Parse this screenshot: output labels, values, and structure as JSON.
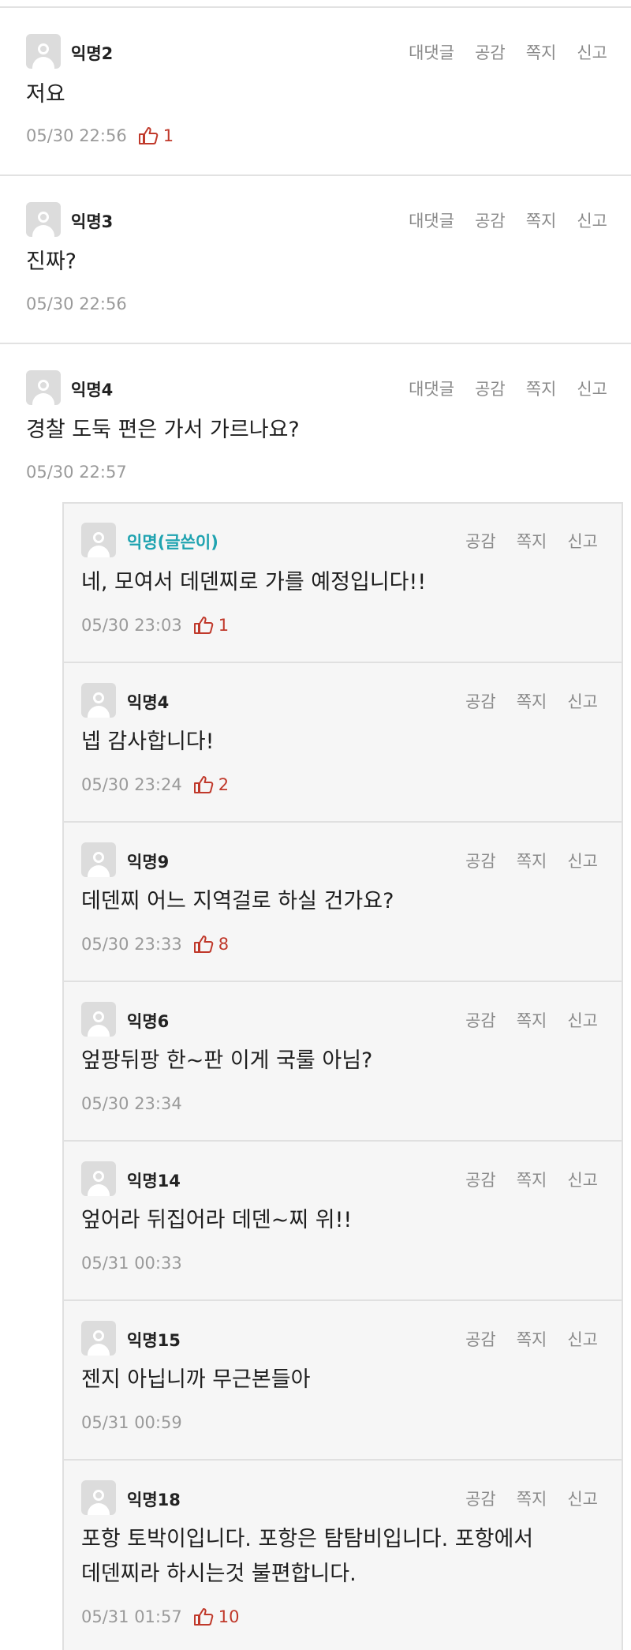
{
  "actions": {
    "reply": "대댓글",
    "like": "공감",
    "message": "쪽지",
    "report": "신고"
  },
  "icons": {
    "avatar": "default-avatar-icon",
    "like": "thumbs-up-icon"
  },
  "colors": {
    "author_name": "#1fa3b0",
    "like_count": "#c0392b"
  },
  "comments": [
    {
      "name": "익명2",
      "text": "저요",
      "time": "05/30 22:56",
      "likes": "1"
    },
    {
      "name": "익명3",
      "text": "진짜?",
      "time": "05/30 22:56",
      "likes": ""
    },
    {
      "name": "익명4",
      "text": "경찰 도둑 편은 가서 가르나요?",
      "time": "05/30 22:57",
      "likes": ""
    }
  ],
  "replies": [
    {
      "name": "익명(글쓴이)",
      "text": "네, 모여서 데덴찌로 가를 예정입니다!!",
      "time": "05/30 23:03",
      "likes": "1"
    },
    {
      "name": "익명4",
      "text": "넵 감사합니다!",
      "time": "05/30 23:24",
      "likes": "2"
    },
    {
      "name": "익명9",
      "text": "데덴찌 어느 지역걸로 하실 건가요?",
      "time": "05/30 23:33",
      "likes": "8"
    },
    {
      "name": "익명6",
      "text": "엎팡뒤팡 한~판 이게 국룰 아님?",
      "time": "05/30 23:34",
      "likes": ""
    },
    {
      "name": "익명14",
      "text": "엎어라 뒤집어라 데덴~찌 위!!",
      "time": "05/31 00:33",
      "likes": ""
    },
    {
      "name": "익명15",
      "text": "젠지 아닙니까 무근본들아",
      "time": "05/31 00:59",
      "likes": ""
    },
    {
      "name": "익명18",
      "text_lines": [
        "포항 토박이입니다. 포항은 탐탐비입니다. 포항에서",
        "데덴찌라 하시는것 불편합니다."
      ],
      "time": "05/31 01:57",
      "likes": "10"
    }
  ]
}
